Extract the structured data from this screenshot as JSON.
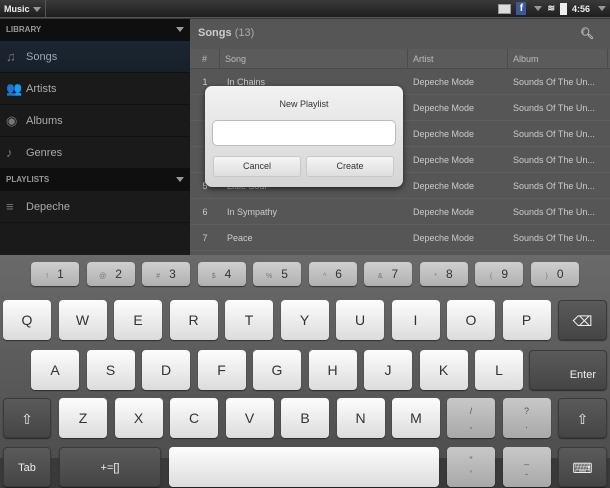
{
  "status": {
    "app": "Music",
    "time": "4:56"
  },
  "sidebar": {
    "library_label": "LIBRARY",
    "playlists_label": "PLAYLISTS",
    "items": [
      {
        "label": "Songs",
        "icon": "♫"
      },
      {
        "label": "Artists",
        "icon": "👥"
      },
      {
        "label": "Albums",
        "icon": "◉"
      },
      {
        "label": "Genres",
        "icon": "♪"
      }
    ],
    "playlists": [
      {
        "label": "Depeche",
        "icon": "≡"
      }
    ]
  },
  "main": {
    "title": "Songs",
    "count": "(13)",
    "columns": [
      "#",
      "Song",
      "Artist",
      "Album"
    ],
    "rows": [
      {
        "n": "1",
        "song": "In Chains",
        "artist": "Depeche Mode",
        "album": "Sounds Of The Un..."
      },
      {
        "n": "",
        "song": "",
        "artist": "Depeche Mode",
        "album": "Sounds Of The Un..."
      },
      {
        "n": "",
        "song": "",
        "artist": "Depeche Mode",
        "album": "Sounds Of The Un..."
      },
      {
        "n": "",
        "song": "",
        "artist": "Depeche Mode",
        "album": "Sounds Of The Un..."
      },
      {
        "n": "5",
        "song": "Little Soul",
        "artist": "Depeche Mode",
        "album": "Sounds Of The Un..."
      },
      {
        "n": "6",
        "song": "In Sympathy",
        "artist": "Depeche Mode",
        "album": "Sounds Of The Un..."
      },
      {
        "n": "7",
        "song": "Peace",
        "artist": "Depeche Mode",
        "album": "Sounds Of The Un..."
      }
    ]
  },
  "dialog": {
    "title": "New Playlist",
    "value": "",
    "cancel": "Cancel",
    "create": "Create"
  },
  "keyboard": {
    "numbers": [
      [
        "!",
        "1"
      ],
      [
        "@",
        "2"
      ],
      [
        "#",
        "3"
      ],
      [
        "$",
        "4"
      ],
      [
        "%",
        "5"
      ],
      [
        "^",
        "6"
      ],
      [
        "&",
        "7"
      ],
      [
        "*",
        "8"
      ],
      [
        "(",
        "9"
      ],
      [
        ")",
        "0"
      ]
    ],
    "row1": [
      "Q",
      "W",
      "E",
      "R",
      "T",
      "Y",
      "U",
      "I",
      "O",
      "P"
    ],
    "row2": [
      "A",
      "S",
      "D",
      "F",
      "G",
      "H",
      "J",
      "K",
      "L"
    ],
    "row3": [
      "Z",
      "X",
      "C",
      "V",
      "B",
      "N",
      "M"
    ],
    "punct3": [
      [
        "/",
        ","
      ],
      [
        "?",
        "."
      ]
    ],
    "punct4": [
      [
        "\"",
        "'"
      ],
      [
        "_",
        "-"
      ]
    ],
    "enter": "Enter",
    "tab": "Tab",
    "symbols": "+=[]",
    "backspace": "⌫",
    "shift": "⇧",
    "hide": "⌨"
  }
}
